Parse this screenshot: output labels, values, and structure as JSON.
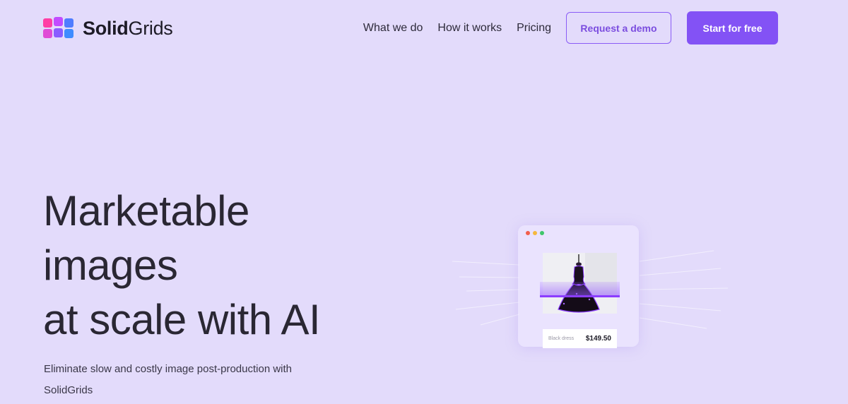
{
  "brand": {
    "name_bold": "Solid",
    "name_regular": "Grids",
    "logo_colors": [
      "#ff3ea5",
      "#c24bff",
      "#4f7cff",
      "#e04bd6",
      "#8a5cff",
      "#3f8cff"
    ]
  },
  "nav": {
    "items": [
      {
        "label": "What we do"
      },
      {
        "label": "How it works"
      },
      {
        "label": "Pricing"
      }
    ],
    "request_demo_label": "Request a demo",
    "start_free_label": "Start for free"
  },
  "hero": {
    "title_lines": [
      "Marketable",
      "images",
      "at scale with AI"
    ],
    "subtitle": "Eliminate slow and costly image post-production with SolidGrids"
  },
  "illustration": {
    "product_name": "Black dress",
    "price": "$149.50",
    "window_dot_colors": [
      "#f25f4c",
      "#f5b83d",
      "#3fc66b"
    ]
  },
  "colors": {
    "background": "#e3dbfb",
    "accent": "#8352f5",
    "text": "#2a2733"
  }
}
